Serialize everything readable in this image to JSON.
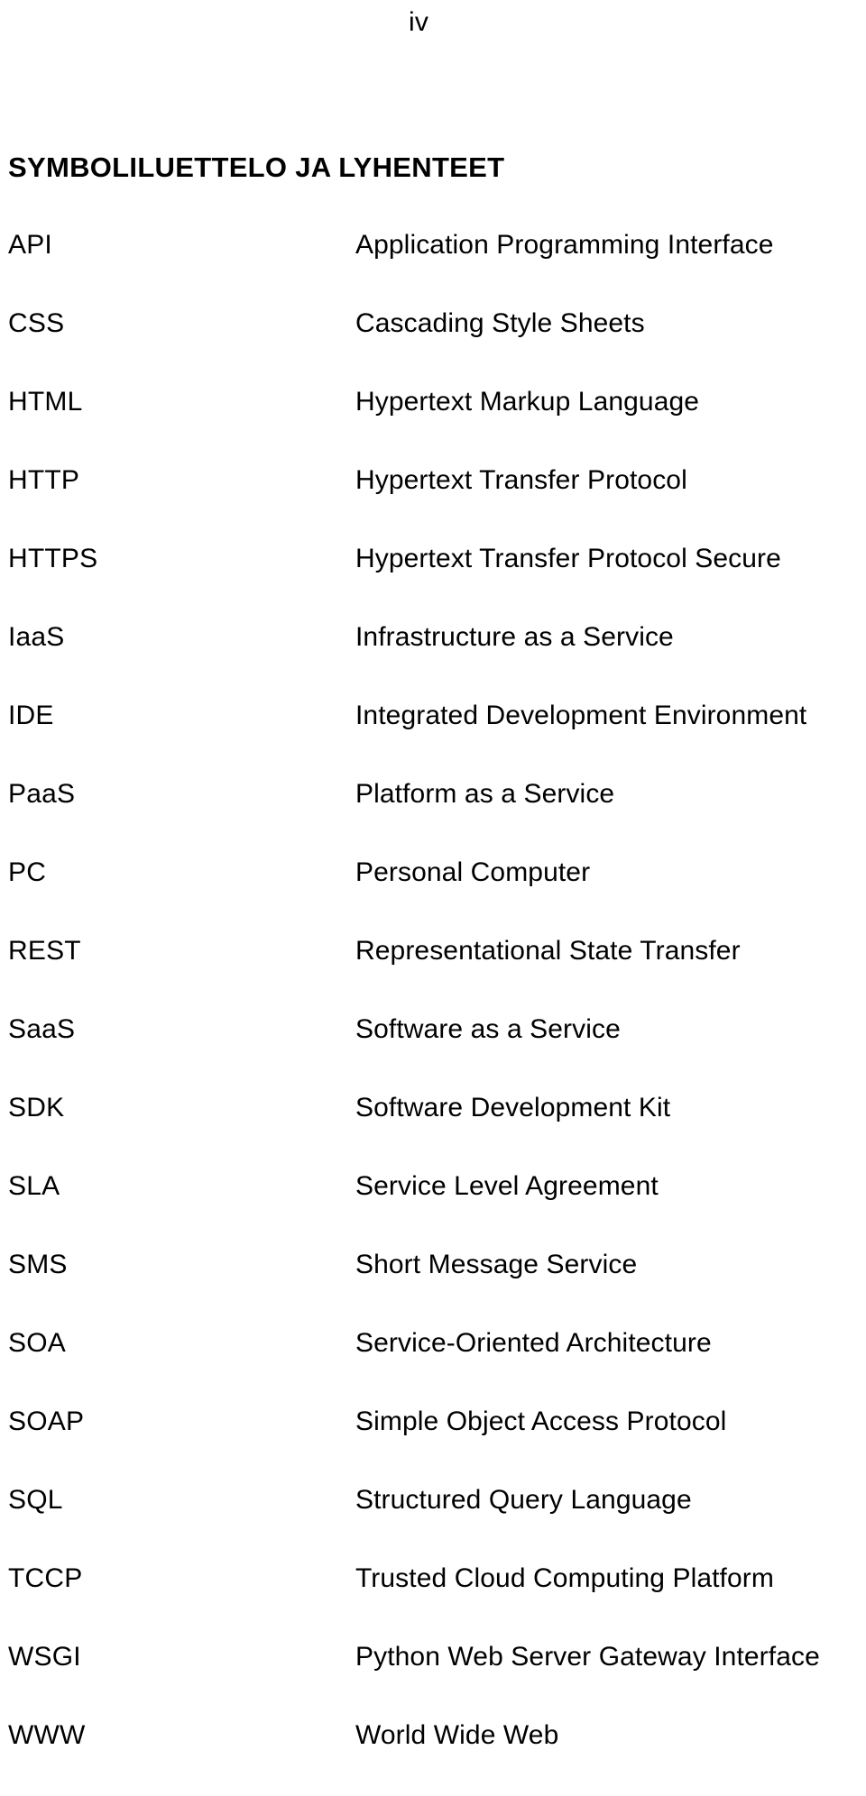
{
  "page": {
    "number": "iv",
    "heading": "SYMBOLILUETTELO JA LYHENTEET"
  },
  "abbreviations": [
    {
      "term": "API",
      "definition": "Application Programming Interface"
    },
    {
      "term": "CSS",
      "definition": "Cascading Style Sheets"
    },
    {
      "term": "HTML",
      "definition": "Hypertext Markup Language"
    },
    {
      "term": "HTTP",
      "definition": "Hypertext Transfer Protocol"
    },
    {
      "term": "HTTPS",
      "definition": "Hypertext Transfer Protocol Secure"
    },
    {
      "term": "IaaS",
      "definition": "Infrastructure as a Service"
    },
    {
      "term": "IDE",
      "definition": "Integrated Development Environment"
    },
    {
      "term": "PaaS",
      "definition": "Platform as a Service"
    },
    {
      "term": "PC",
      "definition": "Personal Computer"
    },
    {
      "term": "REST",
      "definition": "Representational State Transfer"
    },
    {
      "term": "SaaS",
      "definition": "Software as a Service"
    },
    {
      "term": "SDK",
      "definition": "Software Development Kit"
    },
    {
      "term": "SLA",
      "definition": "Service Level Agreement"
    },
    {
      "term": "SMS",
      "definition": "Short Message Service"
    },
    {
      "term": "SOA",
      "definition": "Service-Oriented Architecture"
    },
    {
      "term": "SOAP",
      "definition": "Simple Object Access Protocol"
    },
    {
      "term": "SQL",
      "definition": "Structured Query Language"
    },
    {
      "term": "TCCP",
      "definition": "Trusted Cloud Computing Platform"
    },
    {
      "term": "WSGI",
      "definition": "Python Web Server Gateway Interface"
    },
    {
      "term": "WWW",
      "definition": "World Wide Web"
    }
  ]
}
